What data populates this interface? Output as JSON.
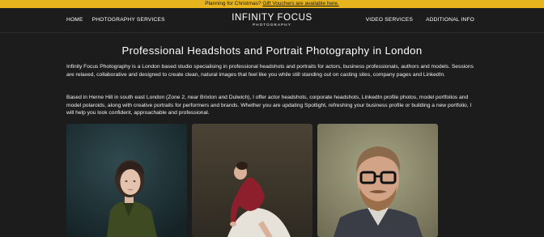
{
  "promo": {
    "text": "Planning for Christmas? ",
    "link_text": "Gift Vouchers are available here."
  },
  "nav": {
    "left": [
      "HOME",
      "PHOTOGRAPHY SERVICES"
    ],
    "right": [
      "VIDEO SERVICES",
      "ADDITIONAL INFO"
    ]
  },
  "logo": {
    "title": "INFINITY FOCUS",
    "subtitle": "PHOTOGRAPHY"
  },
  "main": {
    "heading": "Professional Headshots and Portrait Photography in London",
    "paragraph1": "Infinity Focus Photography is a London based studio specialising in professional headshots and portraits for actors, business professionals, authors and models. Sessions are relaxed, collaborative and designed to create clean, natural images that feel like you while still standing out on casting sites, company pages and LinkedIn.",
    "paragraph2": "Based in Herne Hill in south east London (Zone 2, near Brixton and Dulwich), I offer actor headshots, corporate headshots, LinkedIn profile photos, model portfolios and model polaroids, along with creative portraits for performers and brands. Whether you are updating Spotlight, refreshing your business profile or building a new portfolio, I will help you look confident, approachable and professional."
  },
  "colors": {
    "promo_bg": "#e6b41c",
    "page_bg": "#1c1c1c",
    "text": "#ffffff"
  }
}
